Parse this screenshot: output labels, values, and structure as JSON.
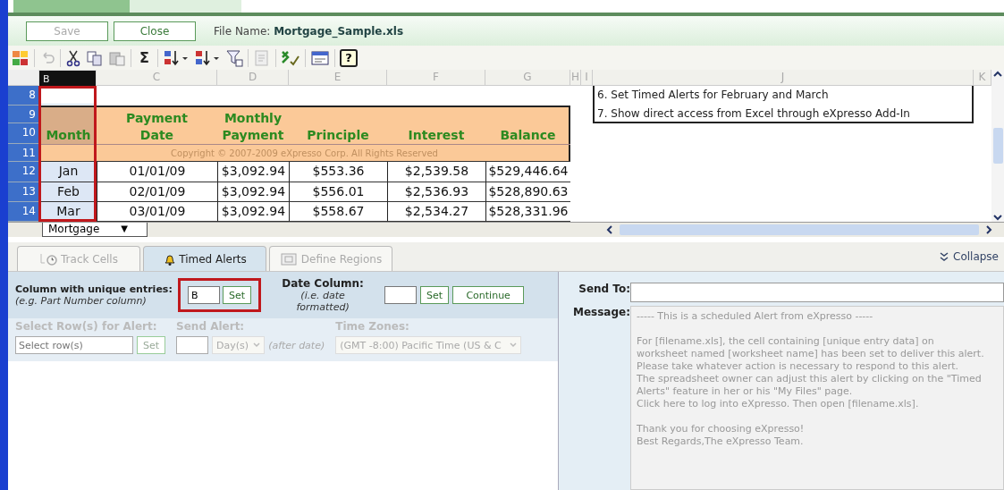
{
  "top_buttons": [
    {
      "label": "Save",
      "disabled": true
    },
    {
      "label": "Close",
      "disabled": false
    }
  ],
  "file_name": {
    "label": "File Name:",
    "value": "Mortgage_Sample.xls"
  },
  "toolbar": {
    "sum_glyph": "Σ",
    "help_glyph": "?"
  },
  "spreadsheet": {
    "columns": [
      {
        "label": "B",
        "selected": true,
        "highlighted": true
      },
      {
        "label": "C",
        "selected": false,
        "highlighted": false
      },
      {
        "label": "D",
        "selected": false,
        "highlighted": false
      },
      {
        "label": "E",
        "selected": false,
        "highlighted": false
      },
      {
        "label": "F",
        "selected": false,
        "highlighted": false
      },
      {
        "label": "G",
        "selected": false,
        "highlighted": false
      },
      {
        "label": "H",
        "selected": false,
        "highlighted": false
      },
      {
        "label": "I",
        "selected": false,
        "highlighted": false
      },
      {
        "label": "J",
        "selected": false,
        "highlighted": false
      },
      {
        "label": "K",
        "selected": false,
        "highlighted": false
      }
    ],
    "row_numbers": [
      "8",
      "9",
      "10",
      "11",
      "12",
      "13",
      "14"
    ],
    "table_headers": [
      {
        "lines": [
          "Month"
        ]
      },
      {
        "lines": [
          "Payment",
          "Date"
        ]
      },
      {
        "lines": [
          "Monthly",
          "Payment"
        ]
      },
      {
        "lines": [
          "Principle"
        ]
      },
      {
        "lines": [
          "Interest"
        ]
      },
      {
        "lines": [
          "Balance"
        ]
      }
    ],
    "copyright": "Copyright © 2007-2009 eXpresso Corp. All Rights Reserved",
    "rows": [
      [
        "Jan",
        "01/01/09",
        "$3,092.94",
        "$553.36",
        "$2,539.58",
        "$529,446.64"
      ],
      [
        "Feb",
        "02/01/09",
        "$3,092.94",
        "$556.01",
        "$2,536.93",
        "$528,890.63"
      ],
      [
        "Mar",
        "03/01/09",
        "$3,092.94",
        "$558.67",
        "$2,534.27",
        "$528,331.96"
      ]
    ],
    "notes": [
      "6. Set Timed Alerts for February and March",
      "7. Show direct access from Excel through eXpresso Add-In"
    ],
    "sheet_tab": {
      "label": "Mortgage",
      "menu_glyph": "▼"
    }
  },
  "tabs": [
    {
      "label": "Track Cells",
      "selected": false,
      "disabled": true
    },
    {
      "label": "Timed Alerts",
      "selected": true,
      "disabled": false
    },
    {
      "label": "Define Regions",
      "selected": false,
      "disabled": true
    }
  ],
  "collapse": "Collapse",
  "form": {
    "unique_column": {
      "label": "Column with unique entries:",
      "hint": "(e.g. Part Number column)",
      "value": "B",
      "button": "Set",
      "highlighted": true
    },
    "date_column": {
      "label": "Date Column:",
      "hint": "(i.e. date formatted)",
      "button": "Set",
      "continue": "Continue"
    },
    "select_rows": {
      "label": "Select Row(s) for Alert:",
      "placeholder": "Select row(s)",
      "button": "Set",
      "disabled": true
    },
    "send_alert": {
      "label": "Send Alert:",
      "unit": "Day(s)",
      "hint": "(after date)",
      "disabled": true
    },
    "time_zones": {
      "label": "Time Zones:",
      "value": "(GMT -8:00) Pacific Time (US & C",
      "disabled": true
    }
  },
  "message_panel": {
    "send_to_label": "Send To:",
    "message_label": "Message:",
    "message_paragraphs": [
      [
        "----- This is a scheduled Alert from eXpresso -----"
      ],
      [
        "For [filename.xls], the cell containing [unique entry data] on",
        "worksheet named [worksheet name] has been set to deliver this alert.",
        "Please take whatever action is necessary to respond to this alert.",
        "The spreadsheet owner can adjust this alert by clicking on the \"Timed",
        "Alerts\" feature in her or his \"My Files\" page.",
        "Click here to log into eXpresso.  Then open [filename.xls]."
      ],
      [
        "Thank you for choosing eXpresso!",
        "Best Regards,The eXpresso Team."
      ]
    ]
  }
}
